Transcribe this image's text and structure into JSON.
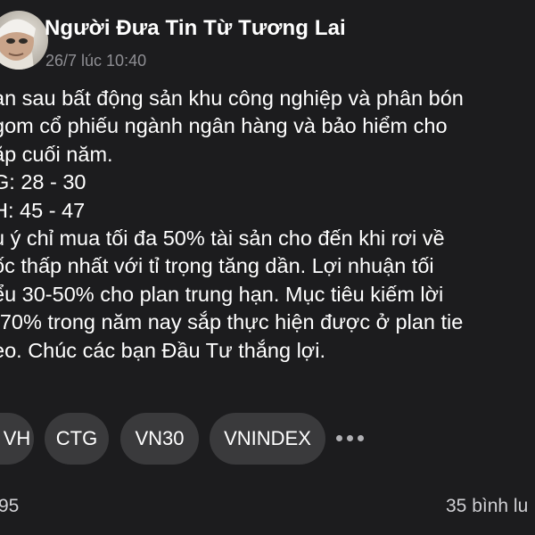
{
  "post": {
    "author_name": "Người Đưa Tin Từ Tương Lai",
    "timestamp": "26/7 lúc 10:40",
    "avatar_icon": "user-avatar-icon",
    "lines": [
      "an sau bất động sản khu công nghiệp và phân bón",
      "gom cổ phiếu ngành ngân hàng và bảo hiểm cho",
      "ặp cuối năm.",
      "G: 28 - 30",
      "H: 45 - 47",
      "u ý chỉ mua tối đa 50% tài sản cho đến khi rơi về",
      "ốc thấp nhất với tỉ trọng tăng dần. Lợi nhuận tối",
      "ểu 30-50% cho plan trung hạn. Mục tiêu kiếm lời",
      "-70% trong năm nay sắp thực hiện được ở plan tie",
      "eo. Chúc các bạn Đầu Tư thắng lợi."
    ]
  },
  "tags": [
    {
      "label": "VH"
    },
    {
      "label": "CTG"
    },
    {
      "label": "VN30"
    },
    {
      "label": "VNINDEX"
    }
  ],
  "more_icon": "more-horizontal-icon",
  "footer": {
    "reactions_count": "95",
    "comments_text": "35 bình lu"
  },
  "colors": {
    "background": "#1c1c1e",
    "text": "#ffffff",
    "muted_text": "#8e8e93",
    "tag_background": "#3a3a3c"
  }
}
